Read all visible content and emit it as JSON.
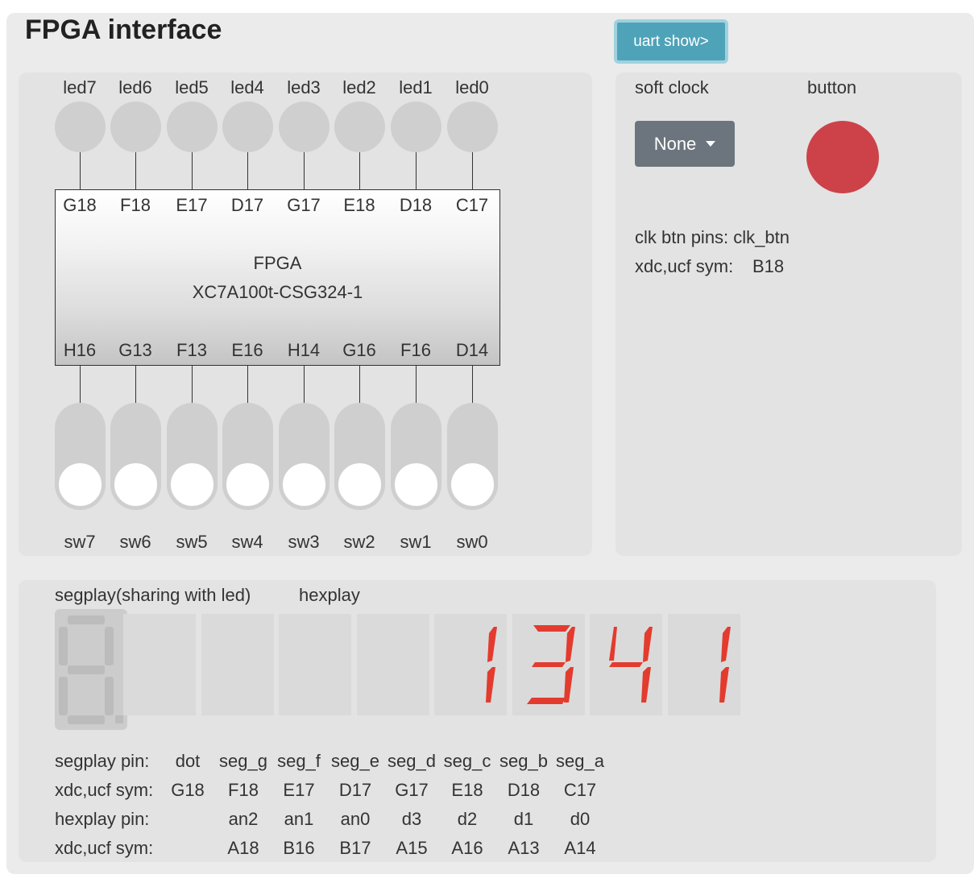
{
  "app_title": "FPGA interface",
  "uart_button": "uart show>",
  "leds": [
    "led7",
    "led6",
    "led5",
    "led4",
    "led3",
    "led2",
    "led1",
    "led0"
  ],
  "led_pins": [
    "G18",
    "F18",
    "E17",
    "D17",
    "G17",
    "E18",
    "D18",
    "C17"
  ],
  "fpga": {
    "name": "FPGA",
    "model": "XC7A100t-CSG324-1"
  },
  "switch_pins": [
    "H16",
    "G13",
    "F13",
    "E16",
    "H14",
    "G16",
    "F16",
    "D14"
  ],
  "switches": [
    "sw7",
    "sw6",
    "sw5",
    "sw4",
    "sw3",
    "sw2",
    "sw1",
    "sw0"
  ],
  "side": {
    "soft_clock_label": "soft clock",
    "button_label": "button",
    "clock_value": "None",
    "clk_pins_text": "clk btn pins: clk_btn",
    "xdc_label": "xdc,ucf sym:",
    "xdc_value": "B18"
  },
  "seg": {
    "segplay_label": "segplay(sharing with led)",
    "hexplay_label": "hexplay",
    "digits": [
      "",
      "",
      "",
      "",
      "1",
      "3",
      "4",
      "1"
    ],
    "digit_color": "#e33b2e",
    "rows": [
      {
        "label": "segplay pin:",
        "cells": [
          "dot",
          "seg_g",
          "seg_f",
          "seg_e",
          "seg_d",
          "seg_c",
          "seg_b",
          "seg_a"
        ]
      },
      {
        "label": "xdc,ucf sym:",
        "cells": [
          "G18",
          "F18",
          "E17",
          "D17",
          "G17",
          "E18",
          "D18",
          "C17"
        ]
      },
      {
        "label": "hexplay pin:",
        "cells": [
          "",
          "an2",
          "an1",
          "an0",
          "d3",
          "d2",
          "d1",
          "d0"
        ]
      },
      {
        "label": "xdc,ucf sym:",
        "cells": [
          "",
          "A18",
          "B16",
          "B17",
          "A15",
          "A16",
          "A13",
          "A14"
        ]
      }
    ]
  }
}
